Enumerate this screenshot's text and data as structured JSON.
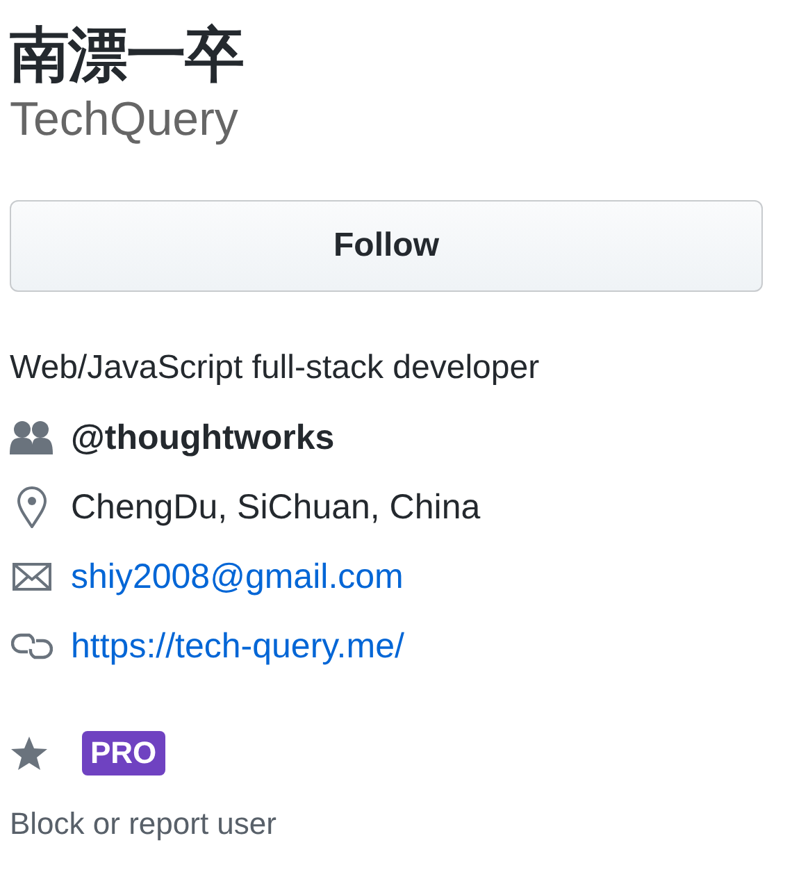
{
  "profile": {
    "name": "南漂一卒",
    "login": "TechQuery"
  },
  "follow_button": {
    "label": "Follow"
  },
  "bio": "Web/JavaScript full-stack developer",
  "details": [
    {
      "kind": "org",
      "text": "@thoughtworks"
    },
    {
      "kind": "location",
      "text": "ChengDu, SiChuan, China"
    },
    {
      "kind": "email",
      "text": "shiy2008@gmail.com"
    },
    {
      "kind": "url",
      "text": "https://tech-query.me/"
    }
  ],
  "badges": [
    {
      "kind": "star"
    },
    {
      "kind": "pro",
      "label": "PRO"
    }
  ],
  "block_link": "Block or report user"
}
